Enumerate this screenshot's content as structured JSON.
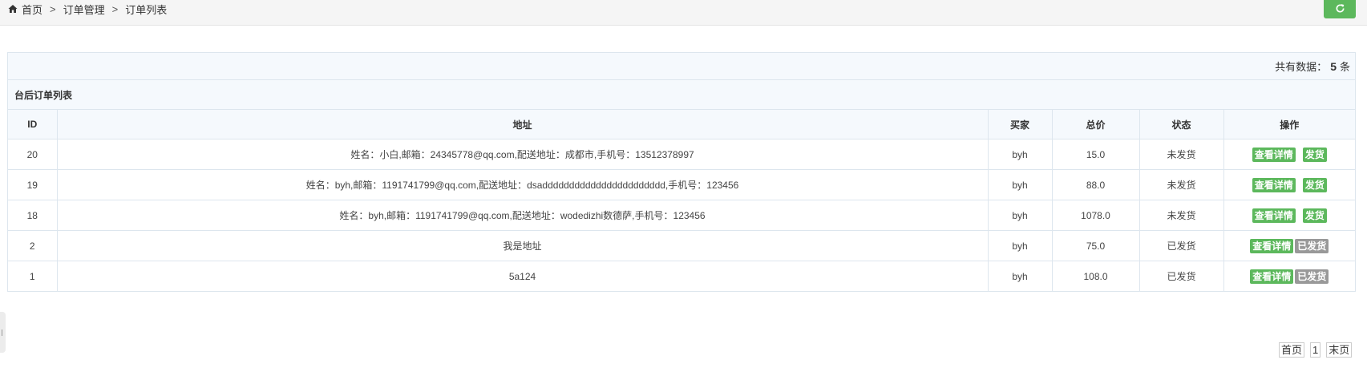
{
  "breadcrumb": {
    "home": "首页",
    "sep1": ">",
    "section": "订单管理",
    "sep2": ">",
    "current": "订单列表"
  },
  "summary": {
    "prefix": "共有数据：",
    "count": "5",
    "suffix": "条"
  },
  "panel_title": "台后订单列表",
  "table": {
    "headers": [
      "ID",
      "地址",
      "买家",
      "总价",
      "状态",
      "操作"
    ],
    "rows": [
      {
        "id": "20",
        "address": "姓名：小白,邮箱：24345778@qq.com,配送地址：成都市,手机号：13512378997",
        "buyer": "byh",
        "total": "15.0",
        "status": "未发货",
        "detail": "查看详情",
        "action": "发货"
      },
      {
        "id": "19",
        "address": "姓名：byh,邮箱：1191741799@qq.com,配送地址：dsaddddddddddddddddddddddd,手机号：123456",
        "buyer": "byh",
        "total": "88.0",
        "status": "未发货",
        "detail": "查看详情",
        "action": "发货"
      },
      {
        "id": "18",
        "address": "姓名：byh,邮箱：1191741799@qq.com,配送地址：wodedizhi数德萨,手机号：123456",
        "buyer": "byh",
        "total": "1078.0",
        "status": "未发货",
        "detail": "查看详情",
        "action": "发货"
      },
      {
        "id": "2",
        "address": "我是地址",
        "buyer": "byh",
        "total": "75.0",
        "status": "已发货",
        "detail": "查看详情",
        "action": "已发货"
      },
      {
        "id": "1",
        "address": "5a124",
        "buyer": "byh",
        "total": "108.0",
        "status": "已发货",
        "detail": "查看详情",
        "action": "已发货"
      }
    ]
  },
  "pagination": {
    "first": "首页",
    "page": "1",
    "last": "末页"
  },
  "colors": {
    "accent_green": "#5cb85c",
    "muted_gray": "#999999",
    "header_bg": "#f5f9fd"
  },
  "icons": [
    "home-icon",
    "refresh-icon"
  ]
}
